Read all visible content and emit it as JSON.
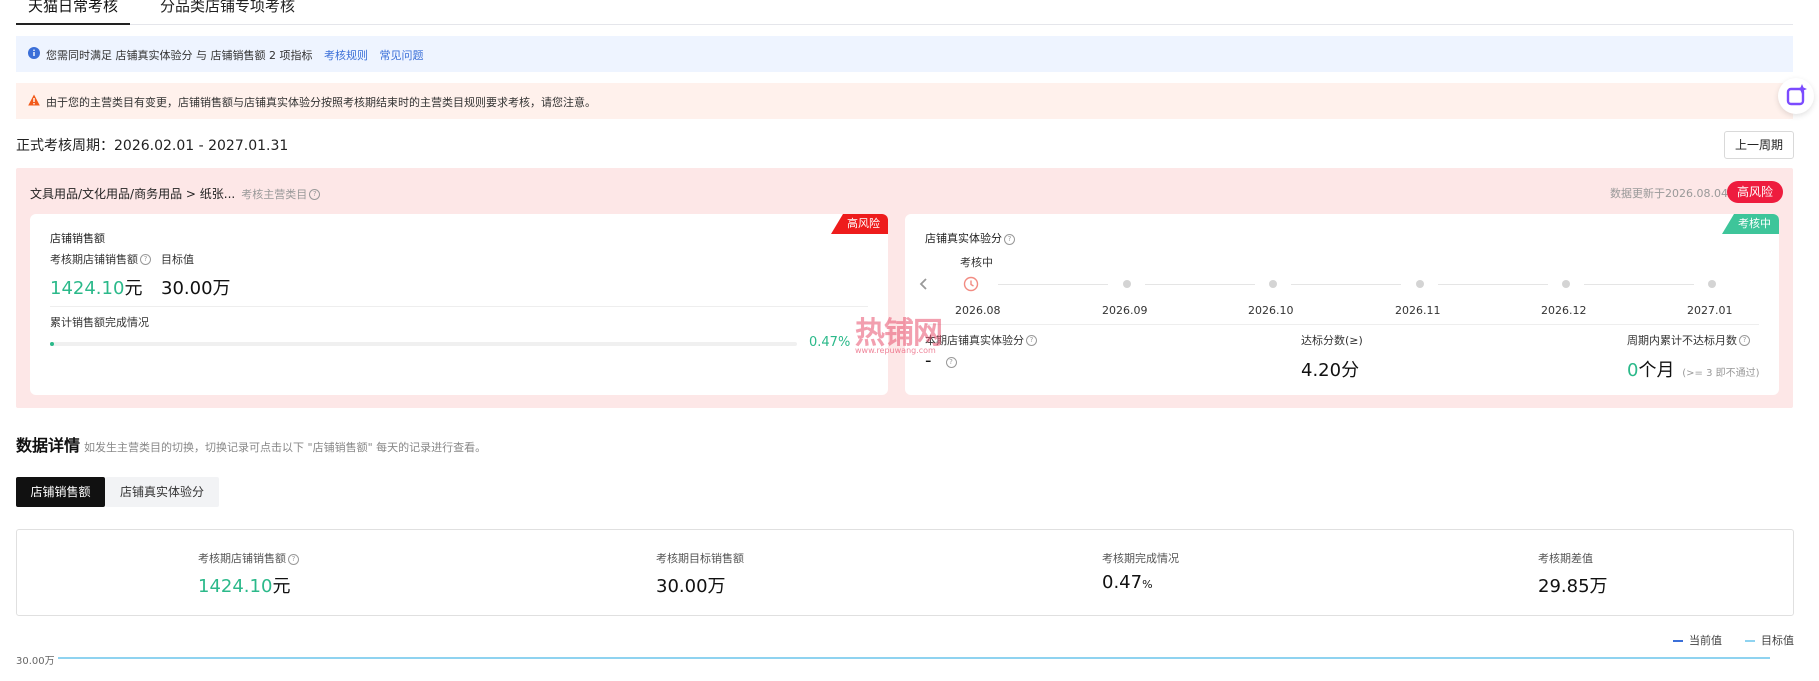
{
  "tabs": [
    {
      "label": "天猫日常考核",
      "active": true
    },
    {
      "label": "分品类店铺专项考核",
      "active": false
    }
  ],
  "info_banner": {
    "text": "您需同时满足 店铺真实体验分 与 店铺销售额 2 项指标",
    "link1": "考核规则",
    "link2": "常见问题"
  },
  "warning_banner": {
    "text": "由于您的主营类目有变更，店铺销售额与店铺真实体验分按照考核期结束时的主营类目规则要求考核，请您注意。"
  },
  "period": {
    "label": "正式考核周期：2026.02.01 - 2027.01.31",
    "prev_button": "上一周期"
  },
  "category": {
    "path": "文具用品/文化用品/商务用品 > 纸张...",
    "hint": "考核主营类目",
    "updated": "数据更新于2026.08.04",
    "risk_badge": "高风险"
  },
  "sales_card": {
    "corner": "高风险",
    "title": "店铺销售额",
    "label_current": "考核期店铺销售额",
    "label_target": "目标值",
    "current_value": "1424.10",
    "current_unit": "元",
    "target_value": "30.00万",
    "progress_label": "累计销售额完成情况",
    "progress_text": "0.47%",
    "progress_fraction": 0.0047
  },
  "experience_card": {
    "corner": "考核中",
    "title": "店铺真实体验分",
    "timeline_status": "考核中",
    "months": [
      "2026.08",
      "2026.09",
      "2026.10",
      "2026.11",
      "2026.12",
      "2027.01"
    ],
    "label_score": "本期店铺真实体验分",
    "score_value": "-",
    "label_target_score": "达标分数(≥)",
    "target_score": "4.20分",
    "label_months": "周期内累计不达标月数",
    "months_value": "0",
    "months_unit": "个月",
    "months_note": "(>= 3 即不通过)"
  },
  "details": {
    "title": "数据详情",
    "hint": "如发生主营类目的切换，切换记录可点击以下 \"店铺销售额\" 每天的记录进行查看。",
    "seg_active": "店铺销售额",
    "seg_inactive": "店铺真实体验分",
    "summary": [
      {
        "label": "考核期店铺销售额",
        "value": "1424.10",
        "unit": "元",
        "green": true,
        "help": true
      },
      {
        "label": "考核期目标销售额",
        "value": "30.00万",
        "unit": "",
        "green": false,
        "help": false
      },
      {
        "label": "考核期完成情况",
        "value": "0.47",
        "unit": "%",
        "green": false,
        "help": false
      },
      {
        "label": "考核期差值",
        "value": "29.85万",
        "unit": "",
        "green": false,
        "help": false
      }
    ],
    "legend_current": "当前值",
    "legend_target": "目标值",
    "y_tick": "30.00万"
  },
  "colors": {
    "accent_green": "#2bb98a",
    "risk_red": "#ee1c3e",
    "panel_pink": "#fde7e7",
    "link_blue": "#3b6fd8"
  },
  "watermark": {
    "main": "热铺网",
    "sub": "www.repuwang.com"
  }
}
